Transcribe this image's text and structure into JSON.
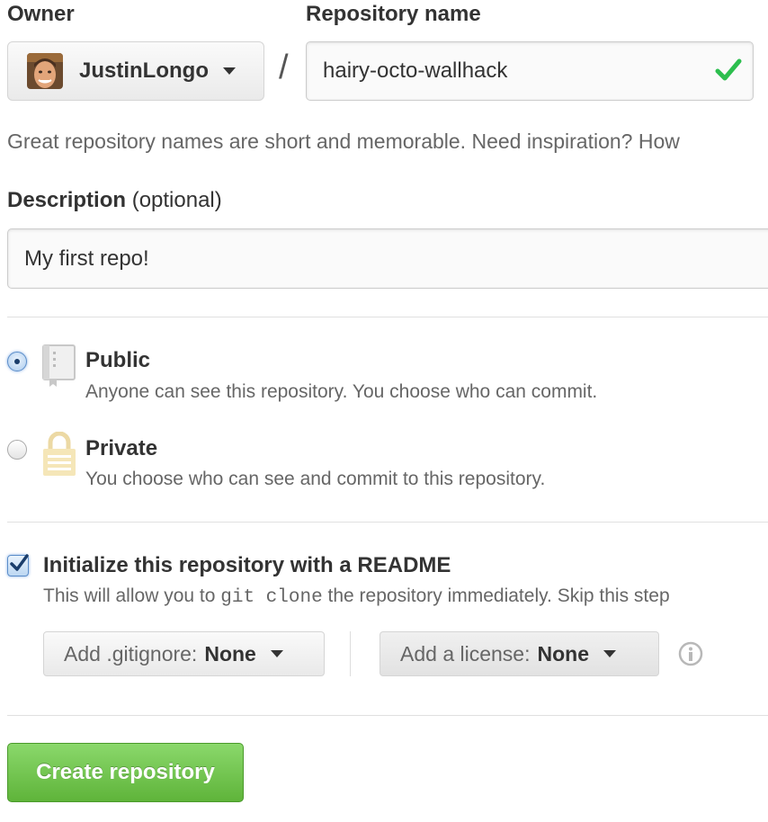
{
  "owner": {
    "label": "Owner",
    "name": "JustinLongo"
  },
  "repository": {
    "label": "Repository name",
    "value": "hairy-octo-wallhack",
    "separator": "/"
  },
  "hint": "Great repository names are short and memorable. Need inspiration? How",
  "description": {
    "label": "Description",
    "optional": "(optional)",
    "value": "My first repo!"
  },
  "visibility": {
    "public": {
      "title": "Public",
      "desc": "Anyone can see this repository. You choose who can commit.",
      "selected": true
    },
    "private": {
      "title": "Private",
      "desc": "You choose who can see and commit to this repository.",
      "selected": false
    }
  },
  "readme": {
    "checked": true,
    "title": "Initialize this repository with a README",
    "desc_prefix": "This will allow you to",
    "desc_code": "git clone",
    "desc_suffix": "the repository immediately. Skip this step"
  },
  "gitignore": {
    "label": "Add .gitignore:",
    "value": "None"
  },
  "license": {
    "label": "Add a license:",
    "value": "None"
  },
  "create_button": "Create repository",
  "colors": {
    "success_green": "#2cbe4e",
    "button_green": "#6cc644",
    "text": "#333333",
    "muted": "#666666"
  },
  "icons": {
    "valid": "check-icon",
    "public": "repo-book-icon",
    "private": "lock-icon",
    "info": "info-icon"
  }
}
